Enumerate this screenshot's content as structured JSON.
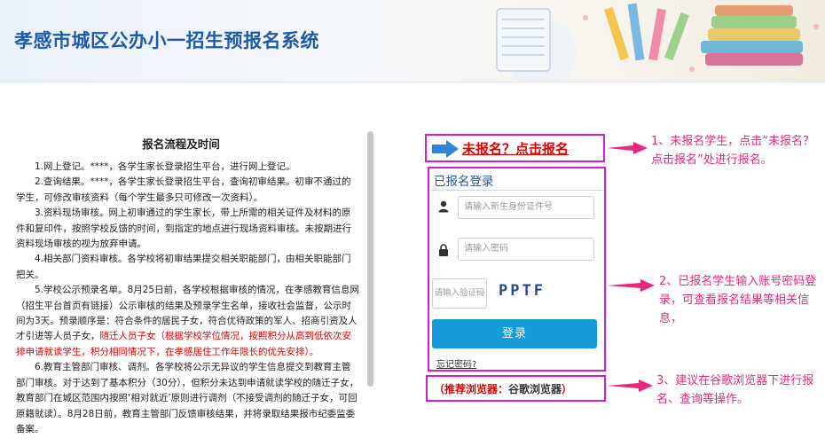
{
  "header": {
    "title": "孝感市城区公办小一招生预报名系统"
  },
  "info": {
    "title": "报名流程及时间",
    "paragraphs": [
      [
        {
          "t": "1.网上登记。****，各学生家长登录招生平台，进行网上登记。"
        }
      ],
      [
        {
          "t": "2.查询结果。****，各学生家长登录招生平台，查询初审结果。初审不通过的学生，可修改审核资料（每个学生最多只可修改一次资料）。"
        }
      ],
      [
        {
          "t": "3.资料现场审核。网上初审通过的学生家长，带上所需的相关证件及材料的原件和复印件，按照学校反馈的时间，到指定的地点进行现场资料审核。未按期进行资料现场审核的视为放弃申请。"
        }
      ],
      [
        {
          "t": "4.相关部门资料审核。各学校将初审结果提交相关职能部门，由相关职能部门把关。"
        }
      ],
      [
        {
          "t": "5.学校公示预录名单。8月25日前，各学校根据审核的情况，在孝感教育信息网（招生平台首页有链接）公示审核的结果及预录学生名单，接收社会监督，公示时间为3天。预录顺序是：符合条件的居民子女，符合优待政策的军人、招商引资及人才引进等人员子女，"
        },
        {
          "t": "随迁人员子女（根据学校学位情况，按照积分从高到低依次安排申请就读学生，积分相同情况下，在孝感居住工作年限长的优先安排）。",
          "red": true
        }
      ],
      [
        {
          "t": "6.教育主管部门审核、调剂。各学校将公示无异议的学生信息提交到教育主管部门审核。对于达到了基本积分（30分），但积分未达到申请就读学校的随迁子女，教育部门在城区范围内按照‘相对就近’原则进行调剂（不接受调剂的随迁子女，可回原籍就读）。8月28日前，教育主管部门反馈审核结果，并将录取结果报市纪委监委备案。"
        }
      ]
    ]
  },
  "register": {
    "label": "未报名？点击报名"
  },
  "login": {
    "title": "已报名登录",
    "id_placeholder": "请输入新生身份证件号",
    "password_placeholder": "请输入密码",
    "captcha_placeholder": "请输入验证码",
    "captcha_code": "PPTF",
    "button": "登录",
    "forgot": "忘记密码?"
  },
  "browser": {
    "prefix": "（推荐浏览器：",
    "name": "谷歌浏览器",
    "suffix": "）"
  },
  "annotations": [
    "1、未报名学生，点击“未报名？点击报名”处进行报名。",
    "2、已报名学生输入账号密码登录，可查看报名结果等相关信息，",
    "3、建议在谷歌浏览器下进行报名、查询等操作。"
  ],
  "colors": {
    "brand": "#1f5aa8",
    "button": "#169cd9",
    "highlight_border": "#d11cd1",
    "alert": "#e00000",
    "annotation": "#e8287f"
  }
}
